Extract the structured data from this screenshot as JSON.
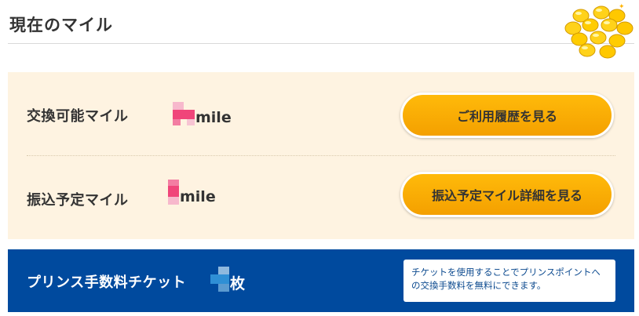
{
  "header": {
    "title": "現在のマイル",
    "coins_icon": "gold-coins-icon"
  },
  "miles": {
    "exchangeable": {
      "label": "交換可能マイル",
      "unit": "mile",
      "button_label": "ご利用履歴を見る"
    },
    "scheduled": {
      "label": "振込予定マイル",
      "unit": "mile",
      "button_label": "振込予定マイル詳細を見る"
    }
  },
  "ticket": {
    "label": "プリンス手数料チケット",
    "unit": "枚",
    "note": "チケットを使用することでプリンスポイントへの交換手数料を無料にできます。"
  },
  "colors": {
    "panel_bg": "#fef3e1",
    "button_orange": "#f7a800",
    "ticket_blue": "#004a9e",
    "redacted_pink": "#f0457a",
    "redacted_blue": "#2f8fd5"
  }
}
